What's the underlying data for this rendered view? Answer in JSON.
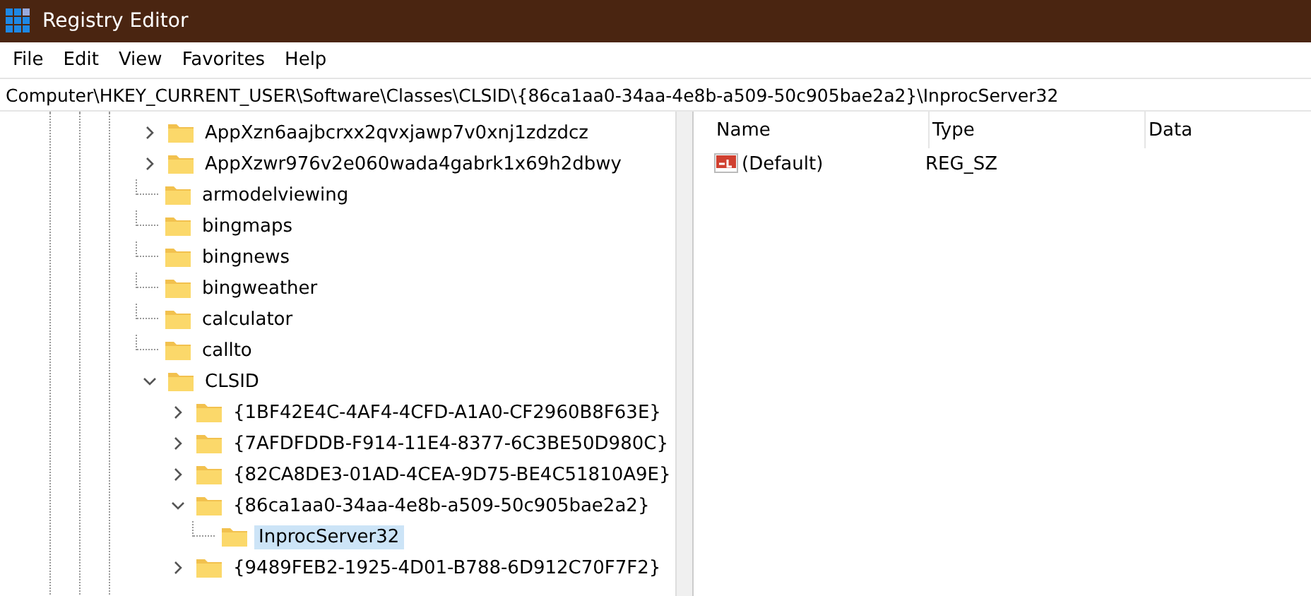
{
  "window": {
    "title": "Registry Editor"
  },
  "menu": [
    "File",
    "Edit",
    "View",
    "Favorites",
    "Help"
  ],
  "address": "Computer\\HKEY_CURRENT_USER\\Software\\Classes\\CLSID\\{86ca1aa0-34aa-4e8b-a509-50c905bae2a2}\\InprocServer32",
  "tree": [
    {
      "label": "AppXzn6aajbcrxx2qvxjawp7v0xnj1zdzdcz",
      "kind": "branch",
      "expanded": false,
      "selected": false
    },
    {
      "label": "AppXzwr976v2e060wada4gabrk1x69h2dbwy",
      "kind": "branch",
      "expanded": false,
      "selected": false
    },
    {
      "label": "armodelviewing",
      "kind": "leaf",
      "selected": false
    },
    {
      "label": "bingmaps",
      "kind": "leaf",
      "selected": false
    },
    {
      "label": "bingnews",
      "kind": "leaf",
      "selected": false
    },
    {
      "label": "bingweather",
      "kind": "leaf",
      "selected": false
    },
    {
      "label": "calculator",
      "kind": "leaf",
      "selected": false
    },
    {
      "label": "callto",
      "kind": "leaf",
      "selected": false
    },
    {
      "label": "CLSID",
      "kind": "branch",
      "expanded": true,
      "selected": false,
      "children": [
        {
          "label": "{1BF42E4C-4AF4-4CFD-A1A0-CF2960B8F63E}",
          "kind": "branch",
          "expanded": false,
          "selected": false
        },
        {
          "label": "{7AFDFDDB-F914-11E4-8377-6C3BE50D980C}",
          "kind": "branch",
          "expanded": false,
          "selected": false
        },
        {
          "label": "{82CA8DE3-01AD-4CEA-9D75-BE4C51810A9E}",
          "kind": "branch",
          "expanded": false,
          "selected": false
        },
        {
          "label": "{86ca1aa0-34aa-4e8b-a509-50c905bae2a2}",
          "kind": "branch",
          "expanded": true,
          "selected": false,
          "children": [
            {
              "label": "InprocServer32",
              "kind": "leaf",
              "selected": true
            }
          ]
        },
        {
          "label": "{9489FEB2-1925-4D01-B788-6D912C70F7F2}",
          "kind": "branch",
          "expanded": false,
          "selected": false
        }
      ]
    }
  ],
  "values": {
    "columns": [
      "Name",
      "Type",
      "Data"
    ],
    "rows": [
      {
        "name": "(Default)",
        "type": "REG_SZ"
      }
    ]
  }
}
